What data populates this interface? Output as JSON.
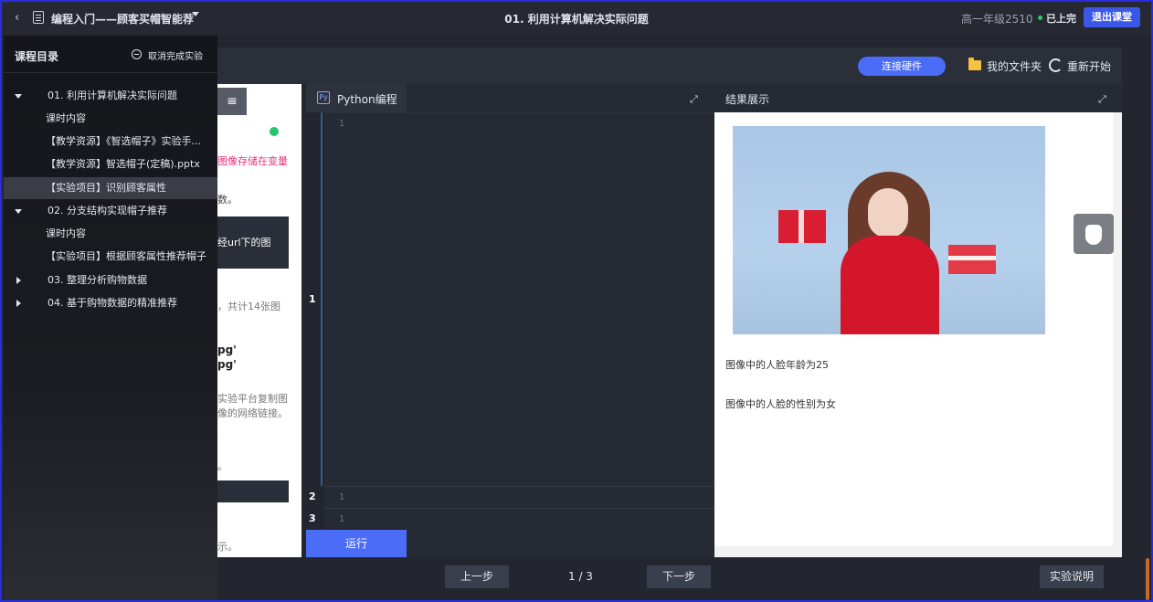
{
  "topbar": {
    "course_title": "编程入门——顾客买帽智能荐",
    "lesson_title": "01. 利用计算机解决实际问题",
    "grade": "高一年级2510",
    "status": "已上完",
    "exit_label": "退出课堂"
  },
  "toolbar": {
    "connect_label": "连接硬件",
    "my_files_label": "我的文件夹",
    "restart_label": "重新开始"
  },
  "sidebar": {
    "title": "课程目录",
    "cancel_label": "取消完成实验",
    "items": [
      {
        "label": "01. 利用计算机解决实际问题",
        "type": "chapter",
        "expanded": true
      },
      {
        "label": "课时内容",
        "type": "sub"
      },
      {
        "label": "【教学资源】《智选帽子》实验手...",
        "type": "sub"
      },
      {
        "label": "【教学资源】智选帽子(定稿).pptx",
        "type": "sub"
      },
      {
        "label": "【实验项目】识别顾客属性",
        "type": "sub",
        "active": true
      },
      {
        "label": "02. 分支结构实现帽子推荐",
        "type": "chapter",
        "expanded": true
      },
      {
        "label": "课时内容",
        "type": "sub"
      },
      {
        "label": "【实验项目】根据顾客属性推荐帽子",
        "type": "sub"
      },
      {
        "label": "03. 整理分析购物数据",
        "type": "chapter",
        "expanded": false
      },
      {
        "label": "04. 基于购物数据的精准推荐",
        "type": "chapter",
        "expanded": false
      }
    ]
  },
  "left_panel": {
    "pink_text": "图像存储在变量",
    "text1": "数。",
    "dark_block": "经url下的图",
    "text2": "，共计14张图",
    "code1": "pg'",
    "code2": "pg'",
    "text3": "实验平台复制图",
    "text4": "像的网络链接。",
    "text5": "。",
    "text6": "示。"
  },
  "code_panel": {
    "tab_label": "Python编程",
    "tab_icon": "Py",
    "cells": [
      {
        "cell_no": "1",
        "line": "1"
      },
      {
        "cell_no": "2",
        "line": "1"
      },
      {
        "cell_no": "3",
        "line": "1"
      }
    ],
    "run_label": "运行"
  },
  "result_panel": {
    "title": "结果展示",
    "age_text": "图像中的人脸年龄为25",
    "gender_text": "图像中的人脸的性别为女"
  },
  "bottom": {
    "prev_label": "上一步",
    "page": "1 / 3",
    "next_label": "下一步",
    "instructions_label": "实验说明"
  }
}
